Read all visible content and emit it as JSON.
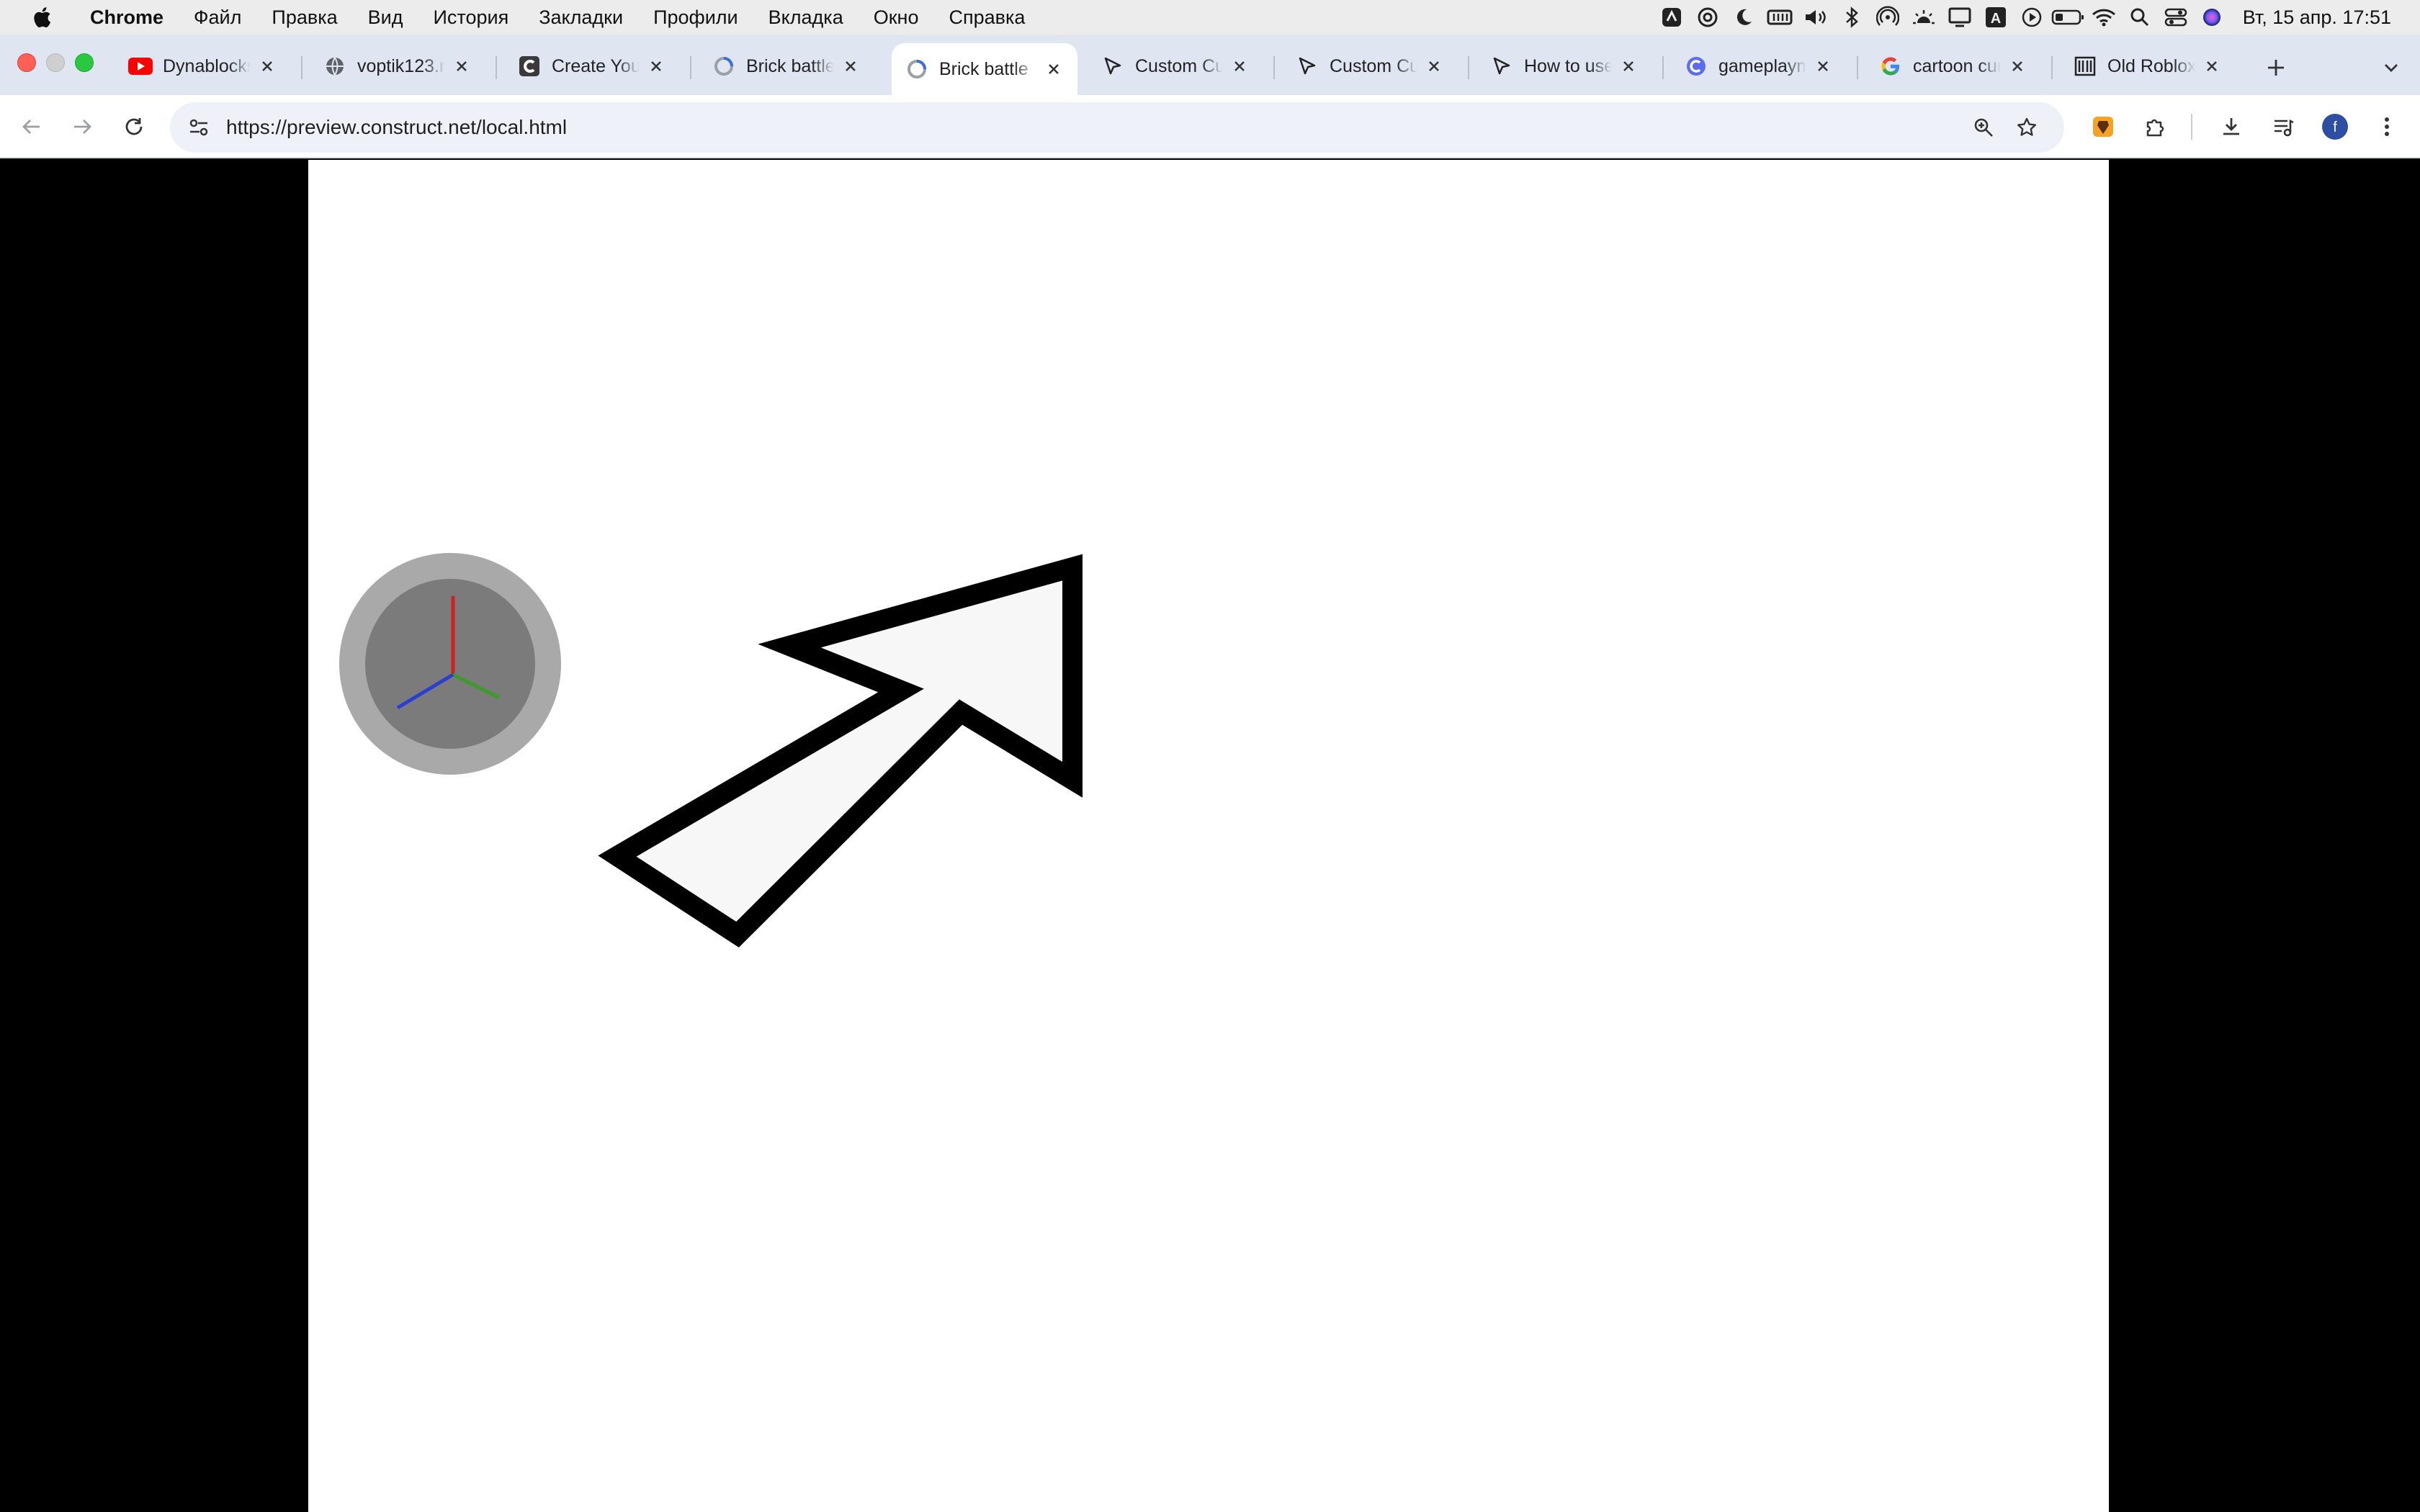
{
  "menubar": {
    "app_name": "Chrome",
    "items": [
      "Файл",
      "Правка",
      "Вид",
      "История",
      "Закладки",
      "Профили",
      "Вкладка",
      "Окно",
      "Справка"
    ],
    "clock": "Вт, 15 апр.  17:51"
  },
  "tabs": [
    {
      "title": "Dynablocks",
      "favicon": "youtube-icon"
    },
    {
      "title": "voptik123.r",
      "favicon": "globe-icon"
    },
    {
      "title": "Create Your",
      "favicon": "construct-icon"
    },
    {
      "title": "Brick battle",
      "favicon": "construct-loading-icon"
    },
    {
      "title": "Brick battle",
      "favicon": "construct-loading-icon",
      "active": true
    },
    {
      "title": "Custom Cu",
      "favicon": "cursor-icon"
    },
    {
      "title": "Custom Cu",
      "favicon": "cursor-icon"
    },
    {
      "title": "How to use",
      "favicon": "cursor-icon"
    },
    {
      "title": "gameplaym",
      "favicon": "gameplay-icon"
    },
    {
      "title": "cartoon cur",
      "favicon": "google-icon"
    },
    {
      "title": "Old Roblox",
      "favicon": "archive-icon"
    }
  ],
  "toolbar": {
    "url": "https://preview.construct.net/local.html",
    "profile_initial": "f"
  },
  "colors": {
    "tab_strip": "#dfe6f2",
    "omnibox": "#eef1f8",
    "game_background": "#ffffff",
    "gizmo_outer": "#a9a9a9",
    "gizmo_inner": "#7b7b7b",
    "axis_x": "#cc2222",
    "axis_y": "#3b9c2b",
    "axis_z": "#2a3fcf"
  }
}
